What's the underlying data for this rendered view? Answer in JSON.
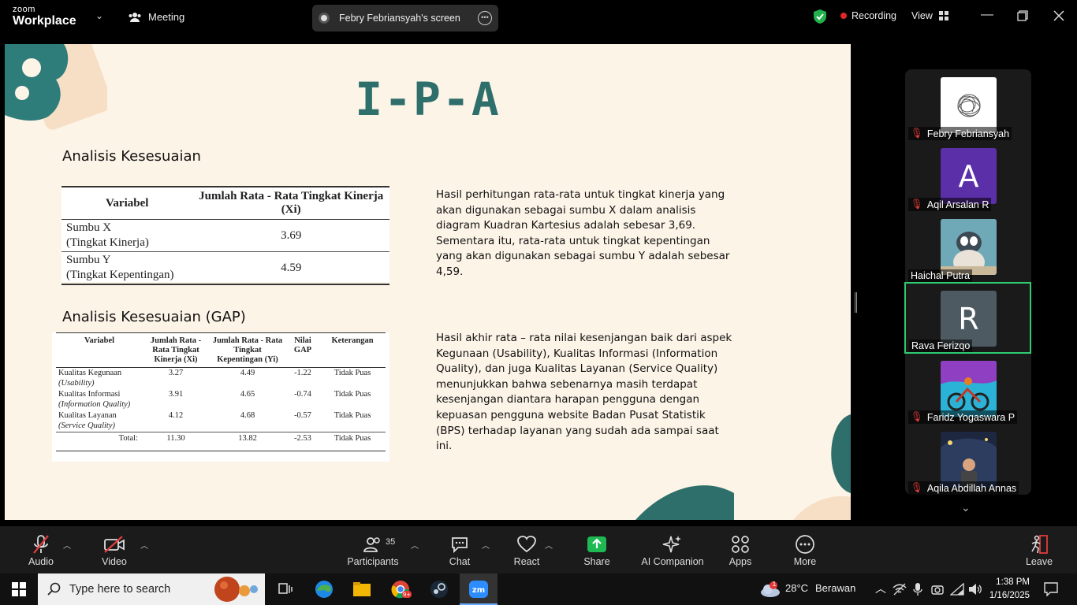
{
  "topbar": {
    "brand_line1": "zoom",
    "brand_line2": "Workplace",
    "meeting_label": "Meeting",
    "share_title": "Febry Febriansyah's screen",
    "recording_label": "Recording",
    "view_label": "View"
  },
  "slide": {
    "title": "I-P-A",
    "section1": "Analisis Kesesuaian",
    "table1": {
      "headers": [
        "Variabel",
        "Jumlah Rata - Rata Tingkat Kinerja (Xi)"
      ],
      "rows": [
        {
          "var1": "Sumbu X",
          "var2": "(Tingkat Kinerja)",
          "value": "3.69"
        },
        {
          "var1": "Sumbu Y",
          "var2": "(Tingkat Kepentingan)",
          "value": "4.59"
        }
      ]
    },
    "paragraph1": "Hasil perhitungan rata-rata untuk tingkat kinerja yang akan digunakan sebagai sumbu X dalam analisis diagram Kuadran Kartesius adalah sebesar 3,69. Sementara itu, rata-rata untuk tingkat kepentingan yang akan digunakan sebagai sumbu Y adalah sebesar 4,59.",
    "section2": "Analisis Kesesuaian (GAP)",
    "table2": {
      "headers": [
        "Variabel",
        "Jumlah Rata - Rata Tingkat Kinerja (Xi)",
        "Jumlah Rata - Rata Tingkat Kepentingan (Yi)",
        "Nilai GAP",
        "Keterangan"
      ],
      "rows": [
        {
          "name": "Kualitas Kegunaan",
          "sub": "(Usability)",
          "xi": "3.27",
          "yi": "4.49",
          "gap": "-1.22",
          "ket": "Tidak Puas"
        },
        {
          "name": "Kualitas Informasi",
          "sub": "(Information Quality)",
          "xi": "3.91",
          "yi": "4.65",
          "gap": "-0.74",
          "ket": "Tidak Puas"
        },
        {
          "name": "Kualitas Layanan",
          "sub": "(Service Quality)",
          "xi": "4.12",
          "yi": "4.68",
          "gap": "-0.57",
          "ket": "Tidak Puas"
        }
      ],
      "total": {
        "label": "Total:",
        "xi": "11.30",
        "yi": "13.82",
        "gap": "-2.53",
        "ket": "Tidak Puas"
      }
    },
    "paragraph2": "Hasil akhir rata – rata nilai kesenjangan baik dari aspek Kegunaan (Usability), Kualitas Informasi (Information Quality), dan juga Kualitas Layanan (Service Quality) menunjukkan bahwa sebenarnya masih terdapat kesenjangan diantara harapan pengguna dengan kepuasan pengguna website Badan Pusat Statistik (BPS) terhadap layanan yang sudah ada sampai saat ini."
  },
  "participants": [
    {
      "name": "Febry Febriansyah",
      "muted": true,
      "avatar": "sketch"
    },
    {
      "name": "Aqil Arsalan R",
      "muted": true,
      "avatar": "letter",
      "letter": "A",
      "color": "#5b2fa8"
    },
    {
      "name": "Haichal Putra",
      "muted": false,
      "avatar": "cartoon"
    },
    {
      "name": "Rava Ferizqo",
      "muted": false,
      "avatar": "letter",
      "letter": "R",
      "color": "#4d5a61",
      "active": true
    },
    {
      "name": "Faridz Yogaswara P",
      "muted": true,
      "avatar": "bike"
    },
    {
      "name": "Aqila Abdillah Annas",
      "muted": true,
      "avatar": "photo"
    }
  ],
  "toolbar": {
    "audio": "Audio",
    "video": "Video",
    "participants": "Participants",
    "participants_count": "35",
    "chat": "Chat",
    "react": "React",
    "share": "Share",
    "ai": "AI Companion",
    "apps": "Apps",
    "more": "More",
    "leave": "Leave"
  },
  "taskbar": {
    "search_placeholder": "Type here to search",
    "weather_temp": "28°C",
    "weather_desc": "Berawan",
    "weather_badge": "1",
    "time": "1:38 PM",
    "date": "1/16/2025"
  },
  "colors": {
    "accent_green": "#2ecc71",
    "share_green": "#1fb954",
    "slide_teal": "#2f6f6b",
    "slide_bg": "#fdf4e8"
  }
}
